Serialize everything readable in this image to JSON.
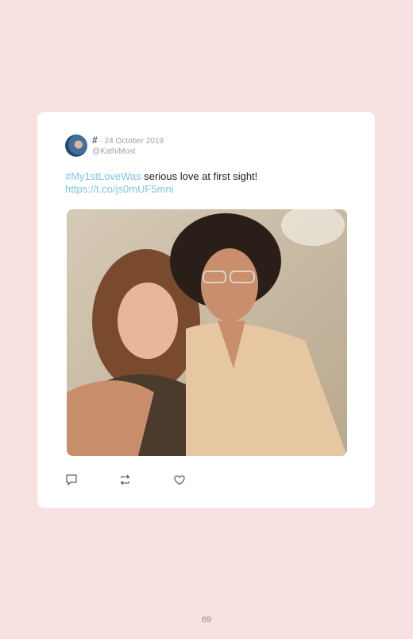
{
  "tweet": {
    "hash_symbol": "#",
    "separator": "·",
    "date": "24 October 2019",
    "handle": "@KathiMost",
    "hashtag": "#My1stLoveWas",
    "text": " serious love at first sight!",
    "link": "https://t.co/js0mUF5mni",
    "actions": {
      "reply_icon": "reply-icon",
      "retweet_icon": "retweet-icon",
      "like_icon": "heart-icon"
    }
  },
  "page": {
    "number": "69"
  },
  "colors": {
    "background": "#f8e1e1",
    "card": "#ffffff",
    "link": "#7cc4e6",
    "muted": "#9aa3aa"
  }
}
